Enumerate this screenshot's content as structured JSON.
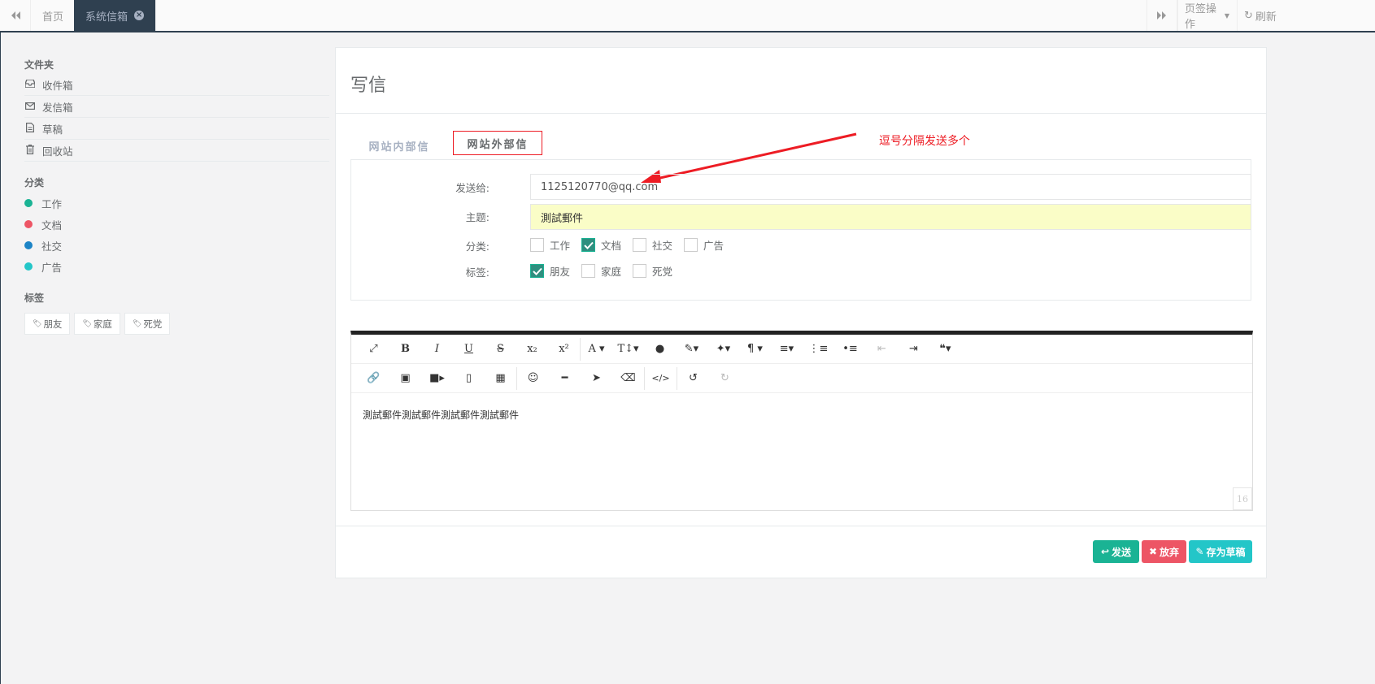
{
  "topbar": {
    "tabs": [
      {
        "label": "首页",
        "active": false
      },
      {
        "label": "系统信箱",
        "active": true
      }
    ],
    "tab_ops_label": "页签操作",
    "refresh_label": "刷新"
  },
  "sidebar": {
    "folders_title": "文件夹",
    "folders": [
      {
        "label": "收件箱",
        "icon": "inbox-icon"
      },
      {
        "label": "发信箱",
        "icon": "envelope-icon"
      },
      {
        "label": "草稿",
        "icon": "file-icon"
      },
      {
        "label": "回收站",
        "icon": "trash-icon"
      }
    ],
    "categories_title": "分类",
    "categories": [
      {
        "label": "工作",
        "color": "#1ab394"
      },
      {
        "label": "文档",
        "color": "#ed5565"
      },
      {
        "label": "社交",
        "color": "#1c84c6"
      },
      {
        "label": "广告",
        "color": "#23c6c8"
      }
    ],
    "tags_title": "标签",
    "tags": [
      "朋友",
      "家庭",
      "死党"
    ]
  },
  "main": {
    "title": "写信",
    "tabs": [
      "网站内部信",
      "网站外部信"
    ],
    "annotation": "逗号分隔发送多个",
    "form": {
      "to_label": "发送给:",
      "to_value": "1125120770@qq.com",
      "subject_label": "主题:",
      "subject_value": "測試郵件",
      "category_label": "分类:",
      "categories": [
        {
          "label": "工作",
          "checked": false
        },
        {
          "label": "文档",
          "checked": true
        },
        {
          "label": "社交",
          "checked": false
        },
        {
          "label": "广告",
          "checked": false
        }
      ],
      "tag_label": "标签:",
      "tags": [
        {
          "label": "朋友",
          "checked": true
        },
        {
          "label": "家庭",
          "checked": false
        },
        {
          "label": "死党",
          "checked": false
        }
      ]
    },
    "editor": {
      "content": "測試郵件測試郵件測試郵件測試郵件",
      "word_count": "16"
    },
    "buttons": {
      "send": "发送",
      "discard": "放弃",
      "save_draft": "存为草稿"
    }
  }
}
